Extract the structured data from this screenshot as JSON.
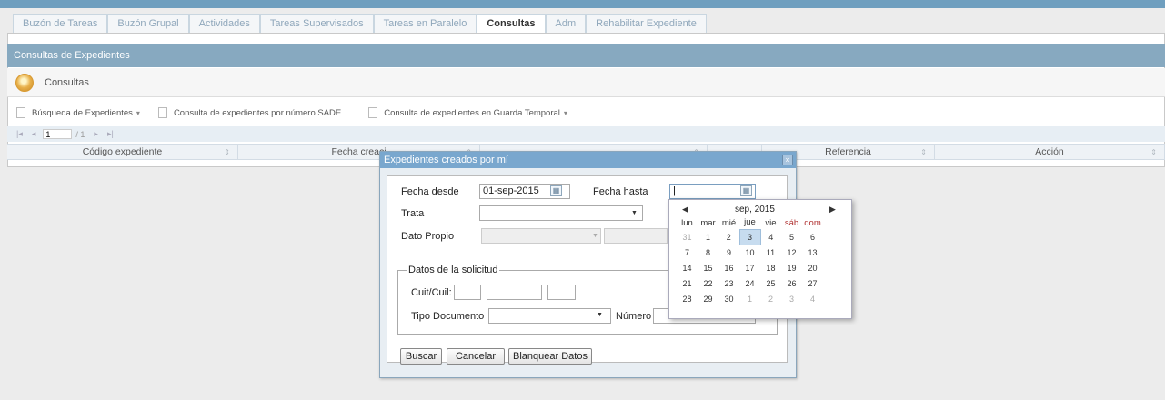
{
  "tabs": [
    {
      "label": "Buzón de Tareas",
      "active": false
    },
    {
      "label": "Buzón Grupal",
      "active": false
    },
    {
      "label": "Actividades",
      "active": false
    },
    {
      "label": "Tareas Supervisados",
      "active": false
    },
    {
      "label": "Tareas en Paralelo",
      "active": false
    },
    {
      "label": "Consultas",
      "active": true
    },
    {
      "label": "Adm",
      "active": false
    },
    {
      "label": "Rehabilitar Expediente",
      "active": false
    }
  ],
  "panel": {
    "title": "Consultas de Expedientes",
    "subtitle": "Consultas"
  },
  "toolbar": {
    "busqueda": "Búsqueda de Expedientes",
    "consulta_sade": "Consulta de expedientes por número SADE",
    "consulta_guarda": "Consulta de expedientes en Guarda Temporal"
  },
  "pager": {
    "page": "1",
    "of": "/ 1"
  },
  "grid": {
    "columns": [
      "Código expediente",
      "Fecha creaci",
      "",
      "",
      "Referencia",
      "Acción"
    ]
  },
  "dialog": {
    "title": "Expedientes creados por mí",
    "close": "×",
    "fecha_desde_label": "Fecha desde",
    "fecha_desde_value": "01-sep-2015",
    "fecha_hasta_label": "Fecha hasta",
    "fecha_hasta_value": "",
    "trata_label": "Trata",
    "dato_propio_label": "Dato Propio",
    "datos_legend": "Datos de la solicitud",
    "cuit_label": "Cuit/Cuil:",
    "tipo_doc_label": "Tipo Documento",
    "numero_label": "Número",
    "buscar": "Buscar",
    "cancelar": "Cancelar",
    "blanquear": "Blanquear Datos"
  },
  "calendar": {
    "title": "sep, 2015",
    "weekdays": [
      "lun",
      "mar",
      "mié",
      "jue",
      "vie",
      "sáb",
      "dom"
    ],
    "weeks": [
      [
        "31",
        "1",
        "2",
        "3",
        "4",
        "5",
        "6"
      ],
      [
        "7",
        "8",
        "9",
        "10",
        "11",
        "12",
        "13"
      ],
      [
        "14",
        "15",
        "16",
        "17",
        "18",
        "19",
        "20"
      ],
      [
        "21",
        "22",
        "23",
        "24",
        "25",
        "26",
        "27"
      ],
      [
        "28",
        "29",
        "30",
        "1",
        "2",
        "3",
        "4"
      ]
    ],
    "today": "3"
  },
  "icons": {
    "calendar": "calendar-icon",
    "close": "close-icon",
    "logo": "consultas-logo-icon"
  }
}
